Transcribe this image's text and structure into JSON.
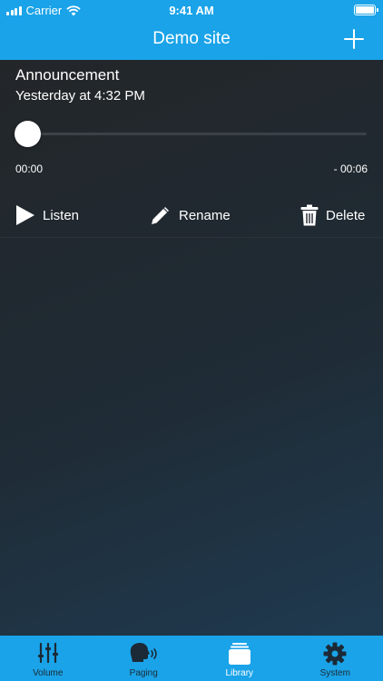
{
  "status_bar": {
    "carrier": "Carrier",
    "time": "9:41 AM"
  },
  "nav": {
    "title": "Demo site",
    "add_icon": "plus-icon"
  },
  "recording": {
    "title": "Announcement",
    "date": "Yesterday at 4:32 PM",
    "elapsed": "00:00",
    "remaining": "- 00:06",
    "progress_fraction": 0
  },
  "actions": {
    "listen": "Listen",
    "rename": "Rename",
    "delete": "Delete"
  },
  "tabs": [
    {
      "label": "Volume",
      "icon": "sliders-icon",
      "active": false
    },
    {
      "label": "Paging",
      "icon": "speaking-head-icon",
      "active": false
    },
    {
      "label": "Library",
      "icon": "library-stack-icon",
      "active": true
    },
    {
      "label": "System",
      "icon": "gear-icon",
      "active": false
    }
  ],
  "colors": {
    "accent": "#1aa3e8",
    "tab_inactive": "#1b2a36",
    "tab_active": "#ffffff"
  }
}
